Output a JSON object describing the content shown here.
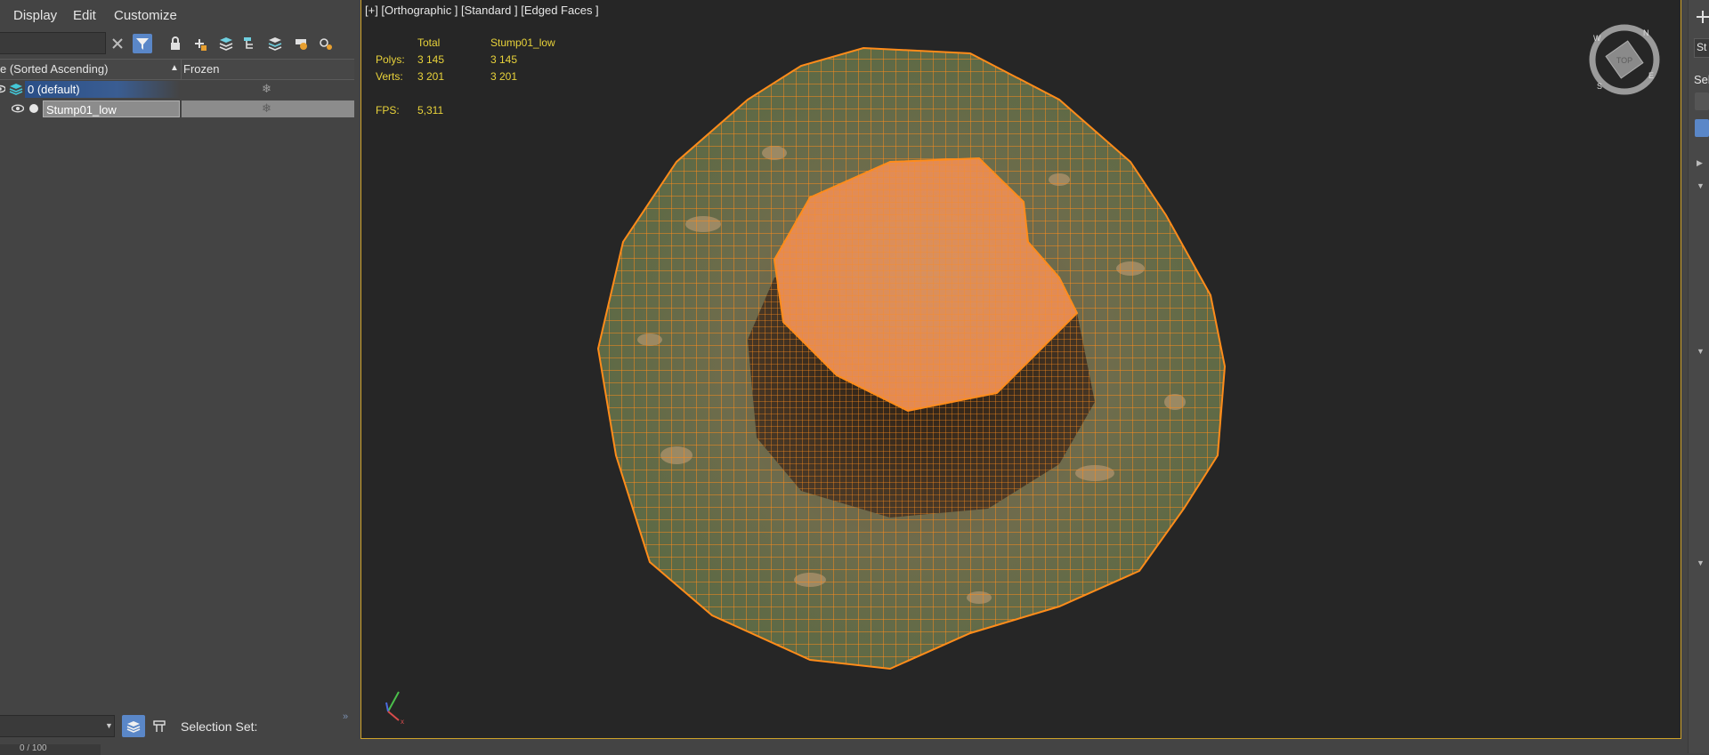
{
  "menu": {
    "display": "Display",
    "edit": "Edit",
    "customize": "Customize"
  },
  "explorer": {
    "columns": {
      "name": "e (Sorted Ascending)",
      "frozen": "Frozen",
      "sort_indicator": "▲"
    },
    "rows": [
      {
        "name": "0 (default)",
        "frozen_icon": "❄"
      },
      {
        "name": "Stump01_low",
        "frozen_icon": "❄"
      }
    ]
  },
  "bottom": {
    "selection_set_label": "Selection Set:",
    "progress_fragment": "0 / 100",
    "expand_glyph": "»"
  },
  "viewport": {
    "label": "[+] [Orthographic ] [Standard ] [Edged Faces ]",
    "stats": {
      "total_header": "Total",
      "object_header": "Stump01_low",
      "polys_label": "Polys:",
      "polys_total": "3 145",
      "polys_object": "3 145",
      "verts_label": "Verts:",
      "verts_total": "3 201",
      "verts_object": "3 201",
      "fps_label": "FPS:",
      "fps_value": "5,311"
    },
    "viewcube_face": "TOP",
    "compass": {
      "n": "N",
      "e": "E",
      "s": "S",
      "w": "W"
    },
    "axes": {
      "x": "x"
    }
  },
  "right_panel": {
    "top_fragment": "St",
    "sel_fragment": "Sel"
  },
  "colors": {
    "accent": "#5a87c8",
    "viewport_border": "#cfa32a",
    "wire": "#ff8c1a",
    "stats_text": "#e8d23a"
  }
}
